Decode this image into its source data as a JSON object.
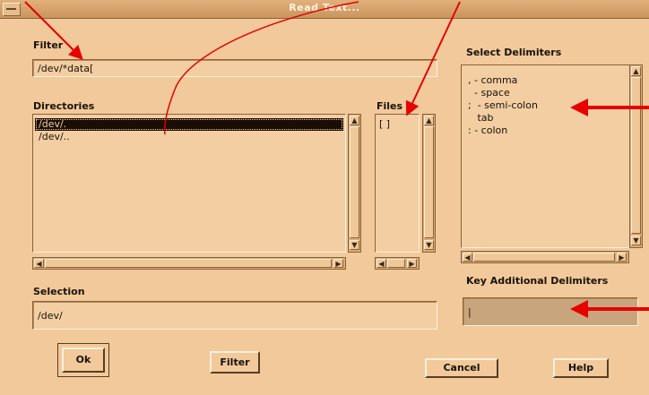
{
  "window": {
    "title": "Read Text..."
  },
  "filter": {
    "label": "Filter",
    "value": "/dev/*data["
  },
  "directories": {
    "label": "Directories",
    "items": [
      "/dev/.",
      "/dev/.."
    ]
  },
  "files": {
    "label": "Files",
    "items": [
      "[ ]"
    ]
  },
  "delimiters": {
    "label": "Select Delimiters",
    "items": [
      ", - comma",
      "  - space",
      ";  - semi-colon",
      "   tab",
      ": - colon"
    ]
  },
  "additional": {
    "label": "Key Additional Delimiters",
    "value": "|"
  },
  "selection": {
    "label": "Selection",
    "value": "/dev/"
  },
  "buttons": {
    "ok": "Ok",
    "filter": "Filter",
    "cancel": "Cancel",
    "help": "Help"
  },
  "colors": {
    "background": "#f1c99b",
    "annotation": "#e60000",
    "selected_row": "#1a0d04"
  }
}
